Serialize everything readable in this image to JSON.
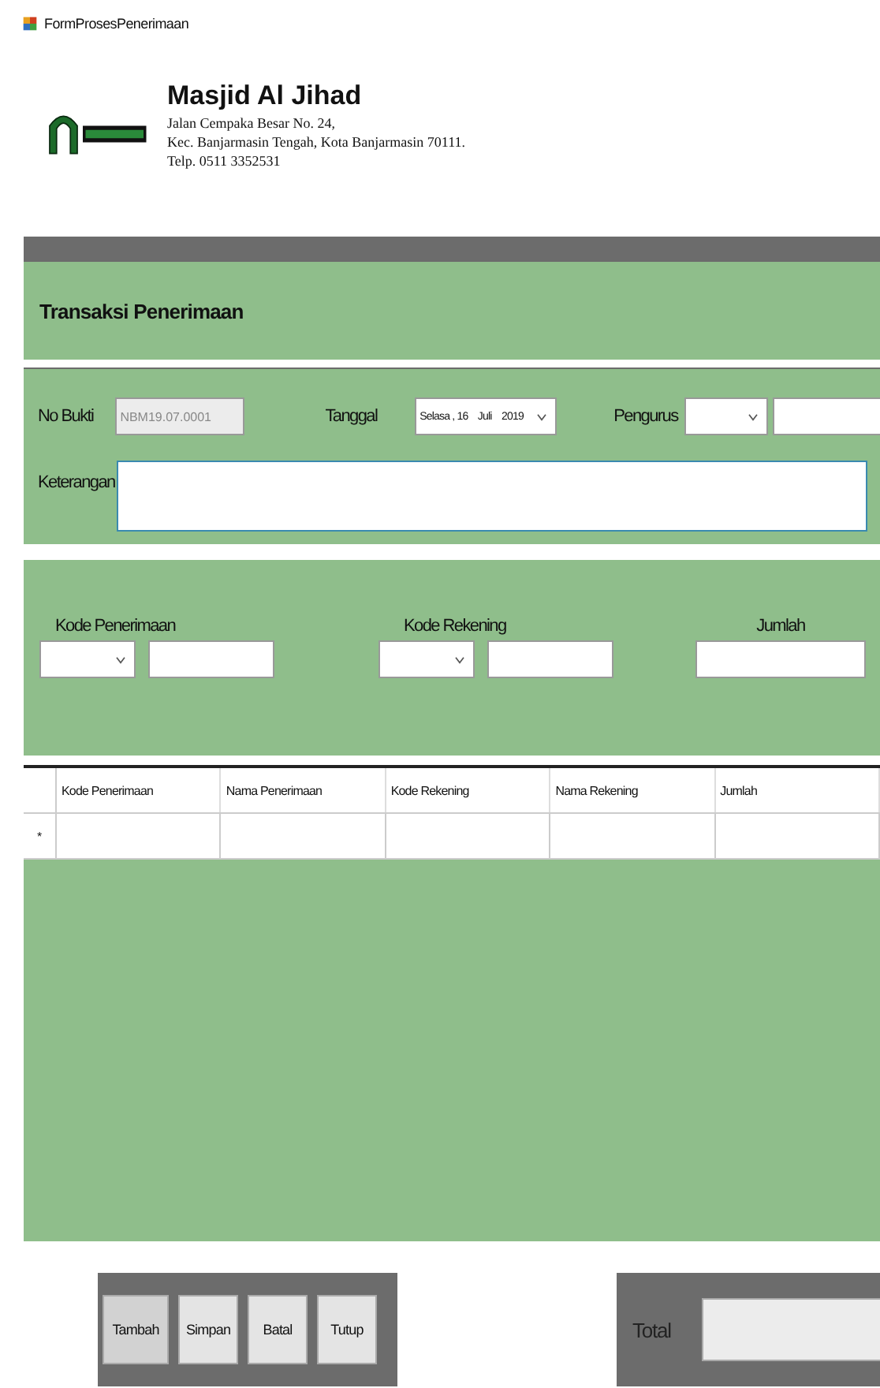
{
  "window": {
    "title": "FormProsesPenerimaan"
  },
  "header": {
    "name": "Masjid Al Jihad",
    "address_lines": [
      "Jalan Cempaka Besar No. 24,",
      "Kec. Banjarmasin Tengah, Kota Banjarmasin 70111.",
      "Telp. 0511 3352531"
    ]
  },
  "section_title": "Transaksi Penerimaan",
  "form": {
    "no_bukti": {
      "label": "No Bukti",
      "value": "NBM19.07.0001",
      "disabled": true
    },
    "tanggal": {
      "label": "Tanggal",
      "value": "Selasa , 16    Juli    2019"
    },
    "pengurus": {
      "label": "Pengurus"
    },
    "keterangan": {
      "label": "Keterangan",
      "focused": true
    }
  },
  "detail": {
    "kode_penerimaan": {
      "label": "Kode Penerimaan"
    },
    "kode_rekening": {
      "label": "Kode Rekening"
    },
    "jumlah": {
      "label": "Jumlah"
    }
  },
  "table": {
    "columns": [
      "Kode Penerimaan",
      "Nama Penerimaan",
      "Kode Rekening",
      "Nama Rekening",
      "Jumlah"
    ],
    "new_row_marker": "*"
  },
  "buttons": [
    {
      "label": "Tambah",
      "selected": true
    },
    {
      "label": "Simpan",
      "selected": false
    },
    {
      "label": "Batal",
      "selected": false
    },
    {
      "label": "Tutup",
      "selected": false
    }
  ],
  "total": {
    "label": "Total"
  }
}
